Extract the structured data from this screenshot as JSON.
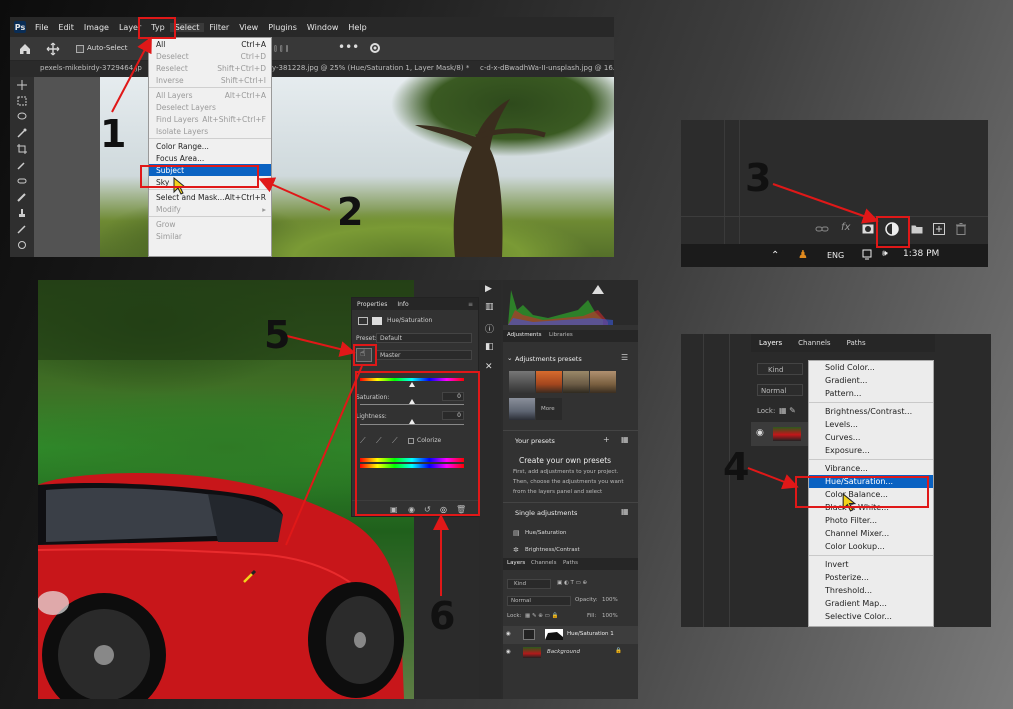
{
  "labels": {
    "n1": "1",
    "n2": "2",
    "n3": "3",
    "n4": "4",
    "n5": "5",
    "n6": "6"
  },
  "panel1": {
    "app_logo": "Ps",
    "menubar": [
      "File",
      "Edit",
      "Image",
      "Layer",
      "Typ",
      "Select",
      "Filter",
      "View",
      "Plugins",
      "Window",
      "Help"
    ],
    "options": {
      "auto_select": "Auto-Select"
    },
    "tabs": [
      "pexels-mikebirdy-3729464.jp",
      "y-381228.jpg @ 25% (Hue/Saturation 1, Layer Mask/8) *",
      "c-d-x-dBwadhWa-II-unsplash.jpg @ 16.79"
    ],
    "select_menu": [
      {
        "label": "All",
        "shortcut": "Ctrl+A",
        "state": "normal"
      },
      {
        "label": "Deselect",
        "shortcut": "Ctrl+D",
        "state": "disabled"
      },
      {
        "label": "Reselect",
        "shortcut": "Shift+Ctrl+D",
        "state": "disabled"
      },
      {
        "label": "Inverse",
        "shortcut": "Shift+Ctrl+I",
        "state": "disabled"
      },
      {
        "sep": true
      },
      {
        "label": "All Layers",
        "shortcut": "Alt+Ctrl+A",
        "state": "disabled"
      },
      {
        "label": "Deselect Layers",
        "shortcut": "",
        "state": "disabled"
      },
      {
        "label": "Find Layers",
        "shortcut": "Alt+Shift+Ctrl+F",
        "state": "disabled"
      },
      {
        "label": "Isolate Layers",
        "shortcut": "",
        "state": "disabled"
      },
      {
        "sep": true
      },
      {
        "label": "Color Range...",
        "shortcut": "",
        "state": "normal"
      },
      {
        "label": "Focus Area...",
        "shortcut": "",
        "state": "normal"
      },
      {
        "label": "Subject",
        "shortcut": "",
        "state": "selected"
      },
      {
        "label": "Sky",
        "shortcut": "",
        "state": "normal"
      },
      {
        "sep": true
      },
      {
        "label": "Select and Mask...",
        "shortcut": "Alt+Ctrl+R",
        "state": "normal"
      },
      {
        "label": "Modify",
        "shortcut": "▸",
        "state": "disabled"
      },
      {
        "sep": true
      },
      {
        "label": "Grow",
        "shortcut": "",
        "state": "disabled"
      },
      {
        "label": "Similar",
        "shortcut": "",
        "state": "disabled"
      }
    ]
  },
  "panel2": {
    "language": "ENG",
    "time": "1:38 PM",
    "fx_label": "fx"
  },
  "panel3": {
    "props_tabs": [
      "Properties",
      "Info"
    ],
    "adjustment_title": "Hue/Saturation",
    "preset_label": "Preset:",
    "preset_value": "Default",
    "channel_value": "Master",
    "sliders": [
      {
        "label": "Hue:",
        "value": "0",
        "position": 0.5
      },
      {
        "label": "Saturation:",
        "value": "0",
        "position": 0.5
      },
      {
        "label": "Lightness:",
        "value": "0",
        "position": 0.5
      }
    ],
    "colorize_label": "Colorize",
    "adj_tabs": [
      "Adjustments",
      "Libraries"
    ],
    "adj_presets_title": "Adjustments presets",
    "more_label": "More",
    "your_presets": "Your presets",
    "create_title": "Create your own presets",
    "create_text_1": "First, add adjustments to your project.",
    "create_text_2": "Then, choose the adjustments you want",
    "create_text_3": "from the layers panel and select",
    "single_adjustments": "Single adjustments",
    "single_items": [
      "Hue/Saturation",
      "Brightness/Contrast"
    ],
    "layers_tabs": [
      "Layers",
      "Channels",
      "Paths"
    ],
    "kind_label": "Kind",
    "blend_mode": "Normal",
    "opacity_label": "Opacity:",
    "opacity_value": "100%",
    "lock_label": "Lock:",
    "fill_label": "Fill:",
    "fill_value": "100%",
    "layers": [
      "Hue/Saturation 1",
      "Background"
    ]
  },
  "panel4": {
    "tabs": [
      "Layers",
      "Channels",
      "Paths"
    ],
    "kind_label": "Kind",
    "blend_mode": "Normal",
    "lock_label": "Lock:",
    "menu_items": [
      {
        "label": "Solid Color..."
      },
      {
        "label": "Gradient..."
      },
      {
        "label": "Pattern..."
      },
      {
        "sep": true
      },
      {
        "label": "Brightness/Contrast..."
      },
      {
        "label": "Levels..."
      },
      {
        "label": "Curves..."
      },
      {
        "label": "Exposure..."
      },
      {
        "sep": true
      },
      {
        "label": "Vibrance..."
      },
      {
        "label": "Hue/Saturation...",
        "selected": true
      },
      {
        "label": "Color Balance..."
      },
      {
        "label": "Black & White..."
      },
      {
        "label": "Photo Filter..."
      },
      {
        "label": "Channel Mixer..."
      },
      {
        "label": "Color Lookup..."
      },
      {
        "sep": true
      },
      {
        "label": "Invert"
      },
      {
        "label": "Posterize..."
      },
      {
        "label": "Threshold..."
      },
      {
        "label": "Gradient Map..."
      },
      {
        "label": "Selective Color..."
      }
    ]
  },
  "colors": {
    "highlight": "#e01818",
    "selection": "#0a62c2",
    "arrow": "#e01818"
  }
}
